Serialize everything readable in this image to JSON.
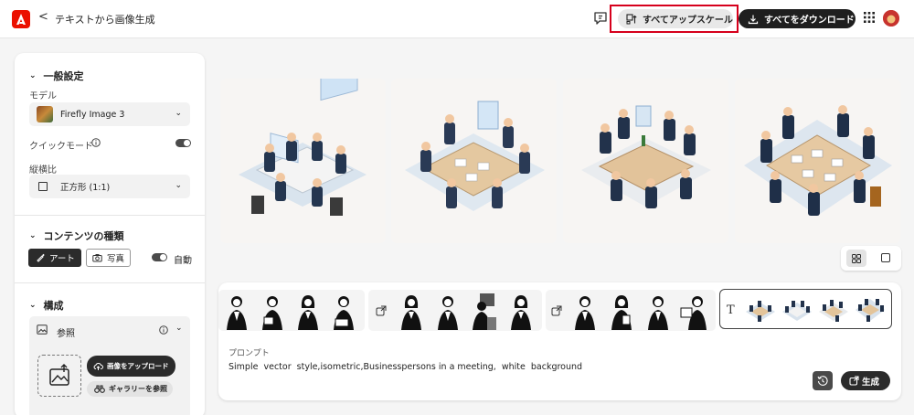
{
  "header": {
    "back_glyph": "<",
    "title": "テキストから画像生成",
    "upscale_all_label": "すべてアップスケール",
    "download_all_label": "すべてをダウンロード",
    "icons": [
      "adobe-logo-icon",
      "chevron-left-icon",
      "feedback-icon",
      "upscale-icon",
      "download-icon",
      "apps-grid-icon",
      "avatar"
    ]
  },
  "sidebar": {
    "general": {
      "heading": "一般設定",
      "model_label": "モデル",
      "model_value": "Firefly Image 3",
      "quick_mode_label": "クイックモード",
      "quick_mode_on": true,
      "aspect_label": "縦横比",
      "aspect_value": "正方形 (1:1)"
    },
    "content_type": {
      "heading": "コンテンツの種類",
      "art_label": "アート",
      "photo_label": "写真",
      "auto_label": "自動",
      "auto_on": false
    },
    "composition": {
      "heading": "構成",
      "reference_label": "参照",
      "upload_label": "画像をアップロード",
      "gallery_label": "ギャラリーを参照"
    }
  },
  "main": {
    "generated_images": [
      "generated-image-1",
      "generated-image-2",
      "generated-image-3",
      "generated-image-4"
    ],
    "view_mode": "grid"
  },
  "prompt_panel": {
    "prompt_label": "プロンプト",
    "prompt_text": "Simple  vector  style,isometric,Businesspersons in a meeting,  white  background",
    "generate_label": "生成",
    "text_mode_glyph": "T"
  },
  "colors": {
    "accent_red": "#eb1000",
    "highlight_red": "#d6001c",
    "dark_button": "#1f1f1f"
  }
}
